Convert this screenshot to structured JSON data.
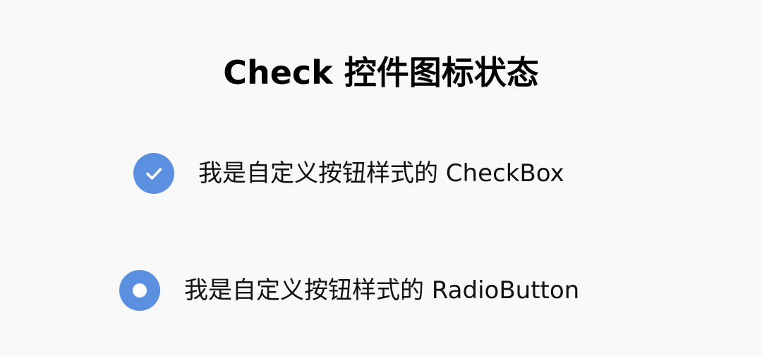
{
  "page": {
    "title": "Check 控件图标状态"
  },
  "checkbox": {
    "label": "我是自定义按钮样式的 CheckBox",
    "checked": true,
    "icon": "check-icon"
  },
  "radio": {
    "label": "我是自定义按钮样式的 RadioButton",
    "selected": true,
    "icon": "radio-dot-icon"
  },
  "colors": {
    "background": "#f9f9fa",
    "accent": "#5b8fe0",
    "text": "#111111",
    "title": "#000000"
  }
}
